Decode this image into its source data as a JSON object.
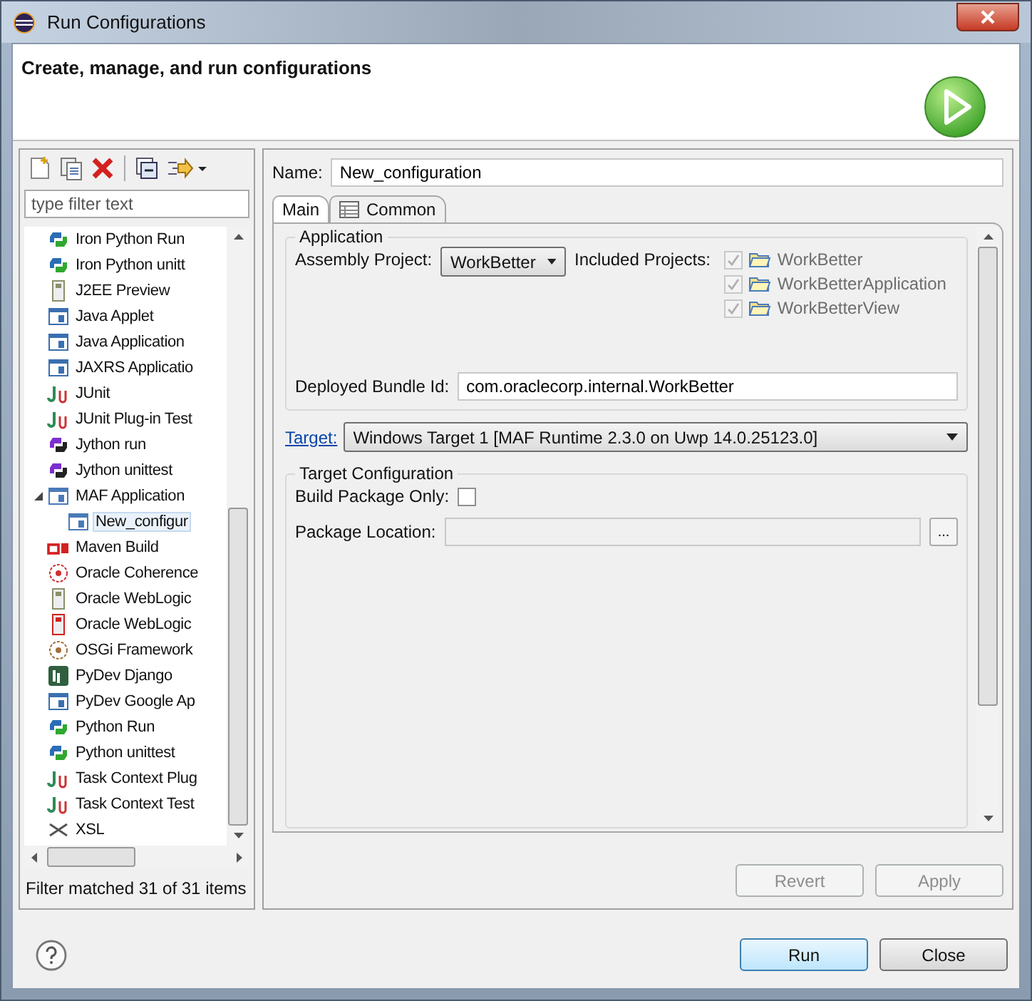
{
  "window": {
    "title": "Run Configurations"
  },
  "header": {
    "title": "Create, manage, and run configurations"
  },
  "filter": {
    "placeholder": "type filter text"
  },
  "tree": [
    {
      "label": "Iron Python Run",
      "kind": "python",
      "selected": false
    },
    {
      "label": "Iron Python unitt",
      "kind": "python",
      "selected": false
    },
    {
      "label": "J2EE Preview",
      "kind": "server",
      "selected": false
    },
    {
      "label": "Java Applet",
      "kind": "java",
      "selected": false
    },
    {
      "label": "Java Application",
      "kind": "java",
      "selected": false
    },
    {
      "label": "JAXRS Applicatio",
      "kind": "java",
      "selected": false
    },
    {
      "label": "JUnit",
      "kind": "junit",
      "selected": false
    },
    {
      "label": "JUnit Plug-in Test",
      "kind": "junit",
      "selected": false
    },
    {
      "label": "Jython run",
      "kind": "jython",
      "selected": false
    },
    {
      "label": "Jython unittest",
      "kind": "jython",
      "selected": false
    },
    {
      "label": "MAF Application",
      "kind": "app",
      "expanded": true,
      "selected": false,
      "children": [
        {
          "label": "New_configur",
          "kind": "app",
          "selected": true
        }
      ]
    },
    {
      "label": "Maven Build",
      "kind": "maven",
      "selected": false
    },
    {
      "label": "Oracle Coherence",
      "kind": "coherence",
      "selected": false
    },
    {
      "label": "Oracle WebLogic",
      "kind": "server",
      "selected": false
    },
    {
      "label": "Oracle WebLogic",
      "kind": "weblogic",
      "selected": false
    },
    {
      "label": "OSGi Framework",
      "kind": "osgi",
      "selected": false
    },
    {
      "label": "PyDev Django",
      "kind": "django",
      "selected": false
    },
    {
      "label": "PyDev Google Ap",
      "kind": "google",
      "selected": false
    },
    {
      "label": "Python Run",
      "kind": "python",
      "selected": false
    },
    {
      "label": "Python unittest",
      "kind": "python",
      "selected": false
    },
    {
      "label": "Task Context Plug",
      "kind": "junit",
      "selected": false
    },
    {
      "label": "Task Context Test",
      "kind": "junit",
      "selected": false
    },
    {
      "label": "XSL",
      "kind": "xsl",
      "selected": false
    }
  ],
  "filter_status": "Filter matched 31 of 31 items",
  "name": {
    "label": "Name:",
    "value": "New_configuration"
  },
  "tabs": [
    {
      "label": "Main",
      "selected": true
    },
    {
      "label": "Common",
      "selected": false
    }
  ],
  "application": {
    "title": "Application",
    "assembly_label": "Assembly Project:",
    "assembly_value": "WorkBetter",
    "included_label": "Included Projects:",
    "projects": [
      {
        "label": "WorkBetter",
        "checked": true,
        "disabled": true
      },
      {
        "label": "WorkBetterApplication",
        "checked": true,
        "disabled": true
      },
      {
        "label": "WorkBetterView",
        "checked": true,
        "disabled": true
      }
    ],
    "bundle_label": "Deployed Bundle Id:",
    "bundle_value": "com.oraclecorp.internal.WorkBetter"
  },
  "target": {
    "link": "Target:",
    "value": "Windows Target 1 [MAF Runtime 2.3.0 on Uwp 14.0.25123.0]"
  },
  "target_config": {
    "title": "Target Configuration",
    "build_label": "Build Package Only:",
    "build_checked": false,
    "location_label": "Package Location:",
    "browse": "..."
  },
  "panel_buttons": [
    {
      "label": "Revert",
      "disabled": true
    },
    {
      "label": "Apply",
      "disabled": true
    }
  ],
  "dialog_buttons": [
    {
      "label": "Run",
      "default": true
    },
    {
      "label": "Close",
      "default": false
    }
  ]
}
